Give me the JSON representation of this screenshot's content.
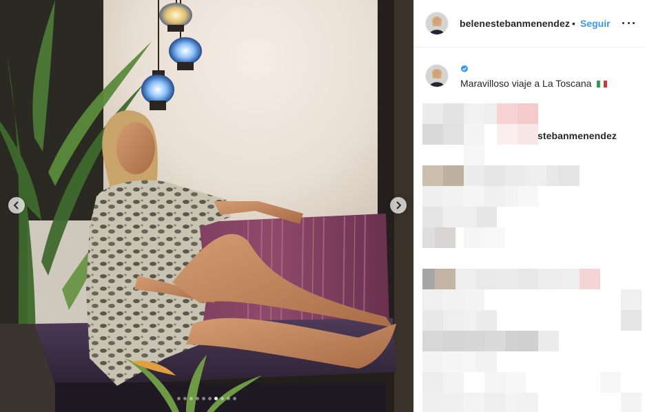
{
  "post": {
    "username": "belenestebanmenendez",
    "bullet": "•",
    "follow_label": "Seguir",
    "more_icon": "more-options-icon",
    "caption": {
      "username": "belenestebanmenendez",
      "verified_icon": "verified-badge-icon",
      "text": "Maravilloso viaje a La Toscana",
      "flag_icon": "italy-flag-icon"
    },
    "carousel": {
      "slide_count": 10,
      "active_slide": 7,
      "prev_icon": "chevron-left-icon",
      "next_icon": "chevron-right-icon"
    }
  },
  "colors": {
    "accent": "#3897f0",
    "text": "#262626",
    "verified": "#3897f0",
    "border": "#efefef"
  }
}
